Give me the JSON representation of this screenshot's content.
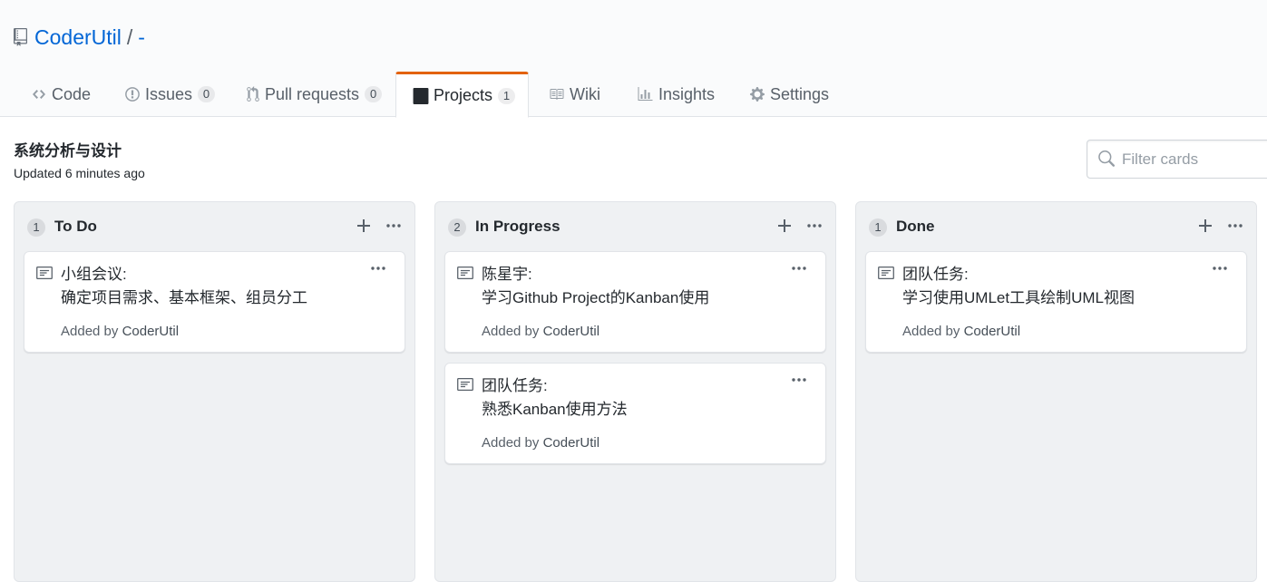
{
  "repo": {
    "owner": "CoderUtil",
    "separator": "/",
    "name": "-"
  },
  "tabs": [
    {
      "label": "Code",
      "icon": "code-icon"
    },
    {
      "label": "Issues",
      "icon": "issue-icon",
      "count": "0"
    },
    {
      "label": "Pull requests",
      "icon": "pull-request-icon",
      "count": "0"
    },
    {
      "label": "Projects",
      "icon": "project-icon",
      "count": "1",
      "selected": true
    },
    {
      "label": "Wiki",
      "icon": "book-icon"
    },
    {
      "label": "Insights",
      "icon": "graph-icon"
    },
    {
      "label": "Settings",
      "icon": "gear-icon"
    }
  ],
  "project": {
    "name": "系统分析与设计",
    "updated": "Updated 6 minutes ago"
  },
  "filter": {
    "placeholder": "Filter cards"
  },
  "colors": {
    "accent": "#0366d6",
    "selected_tab_border": "#e36209",
    "column_bg": "#eff1f3"
  },
  "columns": [
    {
      "count": "1",
      "name": "To Do",
      "cards": [
        {
          "title": "小组会议:",
          "body": "确定项目需求、基本框架、组员分工",
          "added_by_label": "Added by",
          "author": "CoderUtil"
        }
      ]
    },
    {
      "count": "2",
      "name": "In Progress",
      "cards": [
        {
          "title": "陈星宇:",
          "body": "学习Github Project的Kanban使用",
          "added_by_label": "Added by",
          "author": "CoderUtil"
        },
        {
          "title": "团队任务:",
          "body": "熟悉Kanban使用方法",
          "added_by_label": "Added by",
          "author": "CoderUtil"
        }
      ]
    },
    {
      "count": "1",
      "name": "Done",
      "cards": [
        {
          "title": "团队任务:",
          "body": "学习使用UMLet工具绘制UML视图",
          "added_by_label": "Added by",
          "author": "CoderUtil"
        }
      ]
    }
  ]
}
